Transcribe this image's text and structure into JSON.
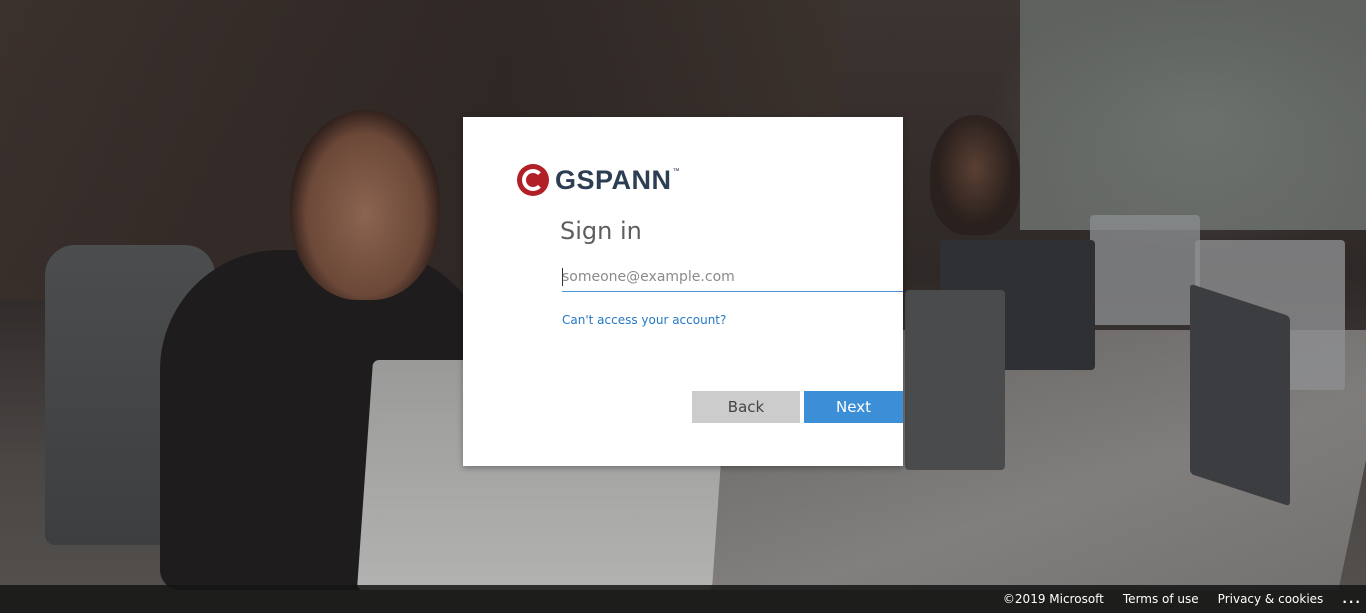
{
  "brand": {
    "mark_letter": "G",
    "name": "GSPANN",
    "trademark": "™",
    "mark_color": "#b22027",
    "name_color": "#2c3e54"
  },
  "signin": {
    "title": "Sign in",
    "email_placeholder": "someone@example.com",
    "email_value": "",
    "help_link": "Can't access your account?",
    "back_label": "Back",
    "next_label": "Next",
    "accent_color": "#3c8fd6",
    "link_color": "#2479c4"
  },
  "footer": {
    "copyright": "©2019 Microsoft",
    "terms": "Terms of use",
    "privacy": "Privacy & cookies",
    "more": "..."
  }
}
